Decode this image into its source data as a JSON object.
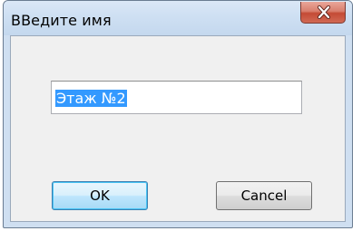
{
  "window": {
    "title": "ВВедите имя",
    "close_glyph": "close-icon"
  },
  "input": {
    "value": "Этаж №2",
    "selected": true
  },
  "buttons": {
    "ok_label": "OK",
    "cancel_label": "Cancel"
  },
  "colors": {
    "titlebar": "#cfe0f3",
    "client": "#f0f0f0",
    "selection": "#3399ff",
    "close_button": "#c44a35"
  }
}
